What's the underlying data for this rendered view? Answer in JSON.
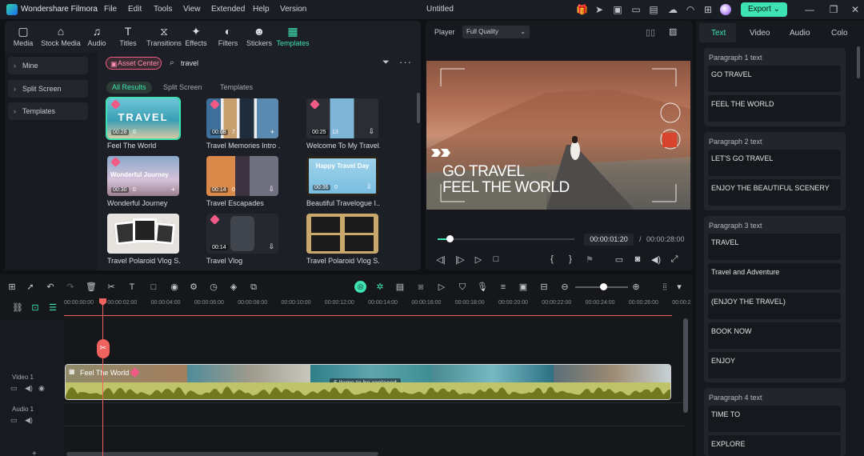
{
  "app": {
    "name": "Wondershare Filmora",
    "doc_title": "Untitled",
    "export_label": "Export"
  },
  "menu": [
    "File",
    "Edit",
    "Tools",
    "View",
    "Extended",
    "Help",
    "Version"
  ],
  "toolbar": [
    {
      "label": "Media",
      "icon": "media-icon"
    },
    {
      "label": "Stock Media",
      "icon": "stock-media-icon"
    },
    {
      "label": "Audio",
      "icon": "audio-icon"
    },
    {
      "label": "Titles",
      "icon": "titles-icon"
    },
    {
      "label": "Transitions",
      "icon": "transitions-icon"
    },
    {
      "label": "Effects",
      "icon": "effects-icon"
    },
    {
      "label": "Filters",
      "icon": "filters-icon"
    },
    {
      "label": "Stickers",
      "icon": "stickers-icon"
    },
    {
      "label": "Templates",
      "icon": "templates-icon",
      "active": true
    }
  ],
  "sidebar": [
    "Mine",
    "Split Screen",
    "Templates"
  ],
  "asset_center": "Asset Center",
  "search": {
    "value": "travel"
  },
  "filters": [
    "All Results",
    "Split Screen",
    "Templates"
  ],
  "cards": [
    {
      "title": "Feel The World",
      "dur": "00:28",
      "count": "0",
      "overlay": "TRAVEL"
    },
    {
      "title": "Travel Memories Intro ...",
      "dur": "00:08",
      "count": "7"
    },
    {
      "title": "Welcome To My Travel...",
      "dur": "00:25",
      "count": "13"
    },
    {
      "title": "Wonderful Journey",
      "dur": "00:30",
      "count": "0",
      "overlay": "Wonderful Journey"
    },
    {
      "title": "Travel Escapades",
      "dur": "00:14",
      "count": "0"
    },
    {
      "title": "Beautiful Travelogue I...",
      "dur": "00:36",
      "count": "0",
      "overlay": "Happy Travel Day"
    },
    {
      "title": "Travel Polaroid Vlog S...",
      "dur": "",
      "count": ""
    },
    {
      "title": "Travel Vlog",
      "dur": "00:14",
      "count": ""
    },
    {
      "title": "Travel Polaroid Vlog S...",
      "dur": "",
      "count": ""
    }
  ],
  "player": {
    "label": "Player",
    "quality": "Full Quality",
    "caption1": "GO TRAVEL",
    "caption2": "FEEL THE WORLD",
    "current_time": "00:00:01:20",
    "separator": "/",
    "total_time": "00:00:28:00",
    "progress": 0.09
  },
  "right_tabs": [
    "Text",
    "Video",
    "Audio",
    "Colo"
  ],
  "paragraphs": [
    {
      "label": "Paragraph 1 text",
      "fields": [
        "GO TRAVEL",
        "FEEL THE WORLD"
      ]
    },
    {
      "label": "Paragraph 2 text",
      "fields": [
        "LET'S GO TRAVEL",
        "ENJOY THE  BEAUTIFUL SCENERY"
      ]
    },
    {
      "label": "Paragraph 3 text",
      "fields": [
        "TRAVEL",
        "Travel and Adventure",
        "(ENJOY THE TRAVEL)",
        "BOOK NOW",
        "ENJOY"
      ]
    },
    {
      "label": "Paragraph 4 text",
      "fields": [
        "TIME TO",
        "EXPLORE"
      ]
    }
  ],
  "ruler": [
    "00:00:00:00",
    "00:00:02:00",
    "00:00:04:00",
    "00:00:06:00",
    "00:00:08:00",
    "00:00:10:00",
    "00:00:12:00",
    "00:00:14:00",
    "00:00:16:00",
    "00:00:18:00",
    "00:00:20:00",
    "00:00:22:00",
    "00:00:24:00",
    "00:00:26:00",
    "00:00:2"
  ],
  "tracks": {
    "video": "Video 1",
    "audio": "Audio 1"
  },
  "clip": {
    "title": "Feel The World",
    "replace_note": "6 items to be replaced"
  },
  "colors": {
    "accent": "#3ee3b3",
    "playhead": "#f0625d",
    "gem": "#f25a86"
  }
}
